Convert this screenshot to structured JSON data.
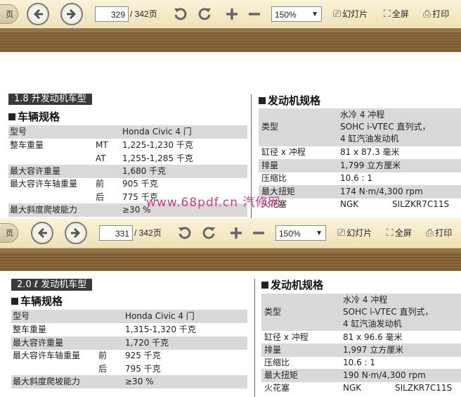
{
  "viewer1": {
    "toolbar": {
      "prev_tab": "页",
      "page": "329",
      "total": "/ 342页",
      "zoom": "150%",
      "slideshow": "幻灯片",
      "fullscreen": "全屏",
      "print": "打印"
    }
  },
  "viewer2": {
    "toolbar": {
      "prev_tab": "页",
      "page": "331",
      "total": "/ 342页",
      "zoom": "150%",
      "slideshow": "幻灯片",
      "fullscreen": "全屏",
      "print": "打印"
    }
  },
  "sheet1": {
    "model_title": "1.8 升发动机车型",
    "vehicle_header": "车辆规格",
    "engine_header": "发动机规格",
    "vehicle": {
      "type_label": "型号",
      "type_value": "Honda Civic 4 门",
      "weight_label": "整车重量",
      "mt": "MT",
      "mt_value": "1,225-1,230 千克",
      "at": "AT",
      "at_value": "1,255-1,285 千克",
      "max_weight_label": "最大容许重量",
      "max_weight_value": "1,680 千克",
      "axle_label": "最大容许车轴重量",
      "front": "前",
      "front_value": "905 千克",
      "rear": "后",
      "rear_value": "775 千克",
      "grade_label": "最大斜度爬坡能力",
      "grade_value": "≥30 %"
    },
    "engine": {
      "type_label": "类型",
      "type_l1": "水冷 4 冲程",
      "type_l2": "SOHC i-VTEC 直列式，",
      "type_l3": "4 缸汽油发动机",
      "bore_label": "缸径 x 冲程",
      "bore_value": "81 x 87.3 毫米",
      "disp_label": "排量",
      "disp_value": "1,799 立方厘米",
      "comp_label": "压缩比",
      "comp_value": "10.6 : 1",
      "torque_label": "最大扭矩",
      "torque_value": "174 N·m/4,300 rpm",
      "plug_label": "火花塞",
      "plug_brand": "NGK",
      "plug_value": "SILZKR7C11S"
    }
  },
  "sheet2": {
    "model_title": "2.0 ℓ 发动机车型",
    "vehicle_header": "车辆规格",
    "engine_header": "发动机规格",
    "vehicle": {
      "type_label": "型号",
      "type_value": "Honda Civic 4 门",
      "weight_label": "整车重量",
      "weight_value": "1,315-1,320 千克",
      "max_weight_label": "最大容许重量",
      "max_weight_value": "1,720 千克",
      "axle_label": "最大容许车轴重量",
      "front": "前",
      "front_value": "925 千克",
      "rear": "后",
      "rear_value": "795 千克",
      "grade_label": "最大斜度爬坡能力",
      "grade_value": "≥30 %"
    },
    "engine": {
      "type_label": "类型",
      "type_l1": "水冷 4 冲程",
      "type_l2": "SOHC i-VTEC 直列式，",
      "type_l3": "4 缸汽油发动机",
      "bore_label": "缸径 x 冲程",
      "bore_value": "81 x 96.6 毫米",
      "disp_label": "排量",
      "disp_value": "1,997 立方厘米",
      "comp_label": "压缩比",
      "comp_value": "10.6 : 1",
      "torque_label": "最大扭矩",
      "torque_value": "190 N·m/4,300 rpm",
      "plug_label": "火花塞",
      "plug_brand": "NGK",
      "plug_value": "SILZKR7C11S"
    }
  },
  "watermark": "www.68pdf.cn 汽修网"
}
